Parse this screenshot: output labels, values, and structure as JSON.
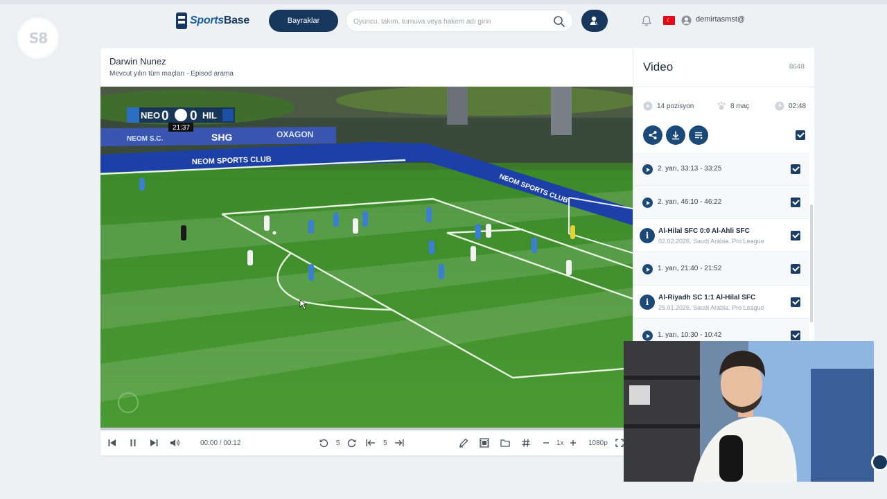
{
  "nav": {
    "site_logo": "S8",
    "brand_prefix": "Sports",
    "brand_suffix": "Base",
    "bayraklar_label": "Bayraklar",
    "search_placeholder": "Oyuncu, takım, turnuva veya hakem adı girin",
    "flag": "TR",
    "username": "demirtasmst@"
  },
  "main": {
    "title": "Darwin Nunez",
    "subtitle": "Mevcut yılın tüm maçları - Episod arama",
    "scoreboard": {
      "home": "NEO",
      "home_score": "0",
      "away_score": "0",
      "away": "HIL",
      "clock": "21:37"
    },
    "ads": [
      "NEOM S.C.",
      "SHG",
      "OXAGON",
      "NEOM SPORTS CLUB",
      "NEOM SPORTS CLUB"
    ],
    "controls": {
      "time": "00:00 / 00:12",
      "rewind_seconds": "5",
      "frame_step": "5",
      "speed": "1x",
      "quality": "1080p"
    }
  },
  "side": {
    "title": "Video",
    "count": "8648",
    "stats": {
      "positions": "14 pozisyon",
      "matches": "8 maç",
      "duration": "02:48"
    },
    "items": [
      {
        "type": "segment",
        "label": "2. yarı, 33:13 - 33:25"
      },
      {
        "type": "segment",
        "label": "2. yarı, 46:10 - 46:22"
      },
      {
        "type": "match",
        "title": "Al-Hilal SFC 0:0 Al-Ahli SFC",
        "meta": "02.02.2026, Saudi Arabia. Pro League"
      },
      {
        "type": "segment",
        "label": "1. yarı, 21:40 - 21:52"
      },
      {
        "type": "match",
        "title": "Al-Riyadh SC 1:1 Al-Hilal SFC",
        "meta": "25.01.2026, Saudi Arabia. Pro League"
      },
      {
        "type": "segment",
        "label": "1. yarı, 10:30 - 10:42"
      }
    ]
  },
  "colors": {
    "navy": "#17385c",
    "accent": "#1b4a78",
    "pitch": "#3f8f2e",
    "flag_red": "#e30a17"
  }
}
